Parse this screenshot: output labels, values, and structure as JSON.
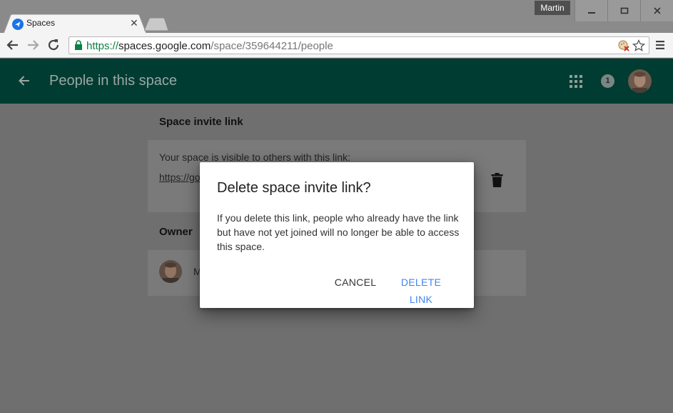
{
  "window": {
    "user_name": "Martin",
    "controls": {
      "minimize": "minimize-icon",
      "maximize": "maximize-icon",
      "close": "close-icon"
    }
  },
  "tabs": [
    {
      "title": "Spaces",
      "active": true
    }
  ],
  "address_bar": {
    "scheme": "https://",
    "host": "spaces.google.com",
    "path": "/space/359644211/people"
  },
  "app": {
    "title": "People in this space",
    "notification_count": "1",
    "brand_color": "#004d40"
  },
  "invite": {
    "heading": "Space invite link",
    "description": "Your space is visible to others with this link:",
    "link_text": "https://go"
  },
  "owner": {
    "heading": "Owner",
    "name_initial": "M"
  },
  "dialog": {
    "title": "Delete space invite link?",
    "body": "If you delete this link, people who already have the link but have not yet joined will no longer be able to access this space.",
    "cancel_label": "CANCEL",
    "confirm_label": "DELETE LINK",
    "confirm_color": "#4285f4"
  }
}
